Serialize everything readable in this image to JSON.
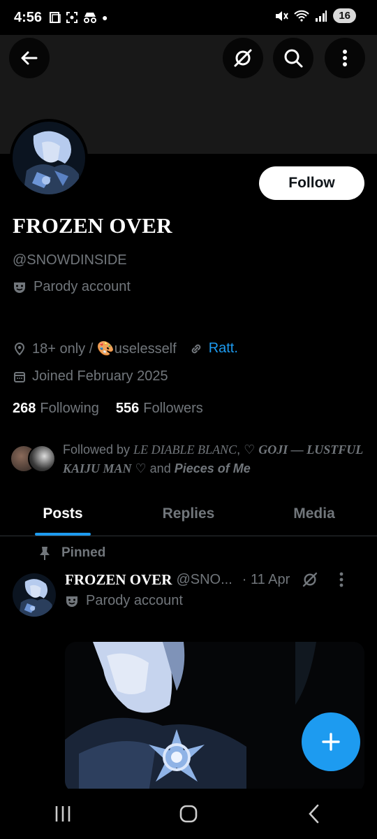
{
  "status_bar": {
    "time": "4:56",
    "battery": "16",
    "network": "5"
  },
  "profile": {
    "display_name": "FROZEN OVER",
    "handle": "@SNOWDINSIDE",
    "parody_label": "Parody account",
    "location_prefix": "18+ only / ",
    "location_emoji": "🎨",
    "location_suffix": "uselesself",
    "link_text": "Ratt.",
    "joined": "Joined February 2025",
    "following_count": "268",
    "following_label": "Following",
    "followers_count": "556",
    "followers_label": "Followers"
  },
  "follow_button": "Follow",
  "followed_by": {
    "prefix": "Followed by ",
    "name1": "LE DIABLE BLANC",
    "sep1": ", ♡ ",
    "name2": "GOJI — LUSTFUL KAIJU MAN",
    "sep2": " ♡ and ",
    "name3": "Pieces of Me"
  },
  "tabs": [
    "Posts",
    "Replies",
    "Media"
  ],
  "pinned_label": "Pinned",
  "tweet": {
    "name": "FROZEN OVER",
    "handle": "@SNO...",
    "date": "· 11 Apr",
    "parody_label": "Parody account"
  },
  "icons": {
    "back": "back-arrow-icon",
    "grok": "grok-icon",
    "search": "search-icon",
    "more": "more-vertical-icon",
    "location": "location-pin-icon",
    "link": "link-icon",
    "calendar": "calendar-icon",
    "parody": "theater-mask-icon",
    "pin": "pin-icon",
    "compose": "plus-icon"
  },
  "colors": {
    "accent": "#1d9bf0",
    "secondary_text": "#71767b",
    "background": "#000000"
  }
}
